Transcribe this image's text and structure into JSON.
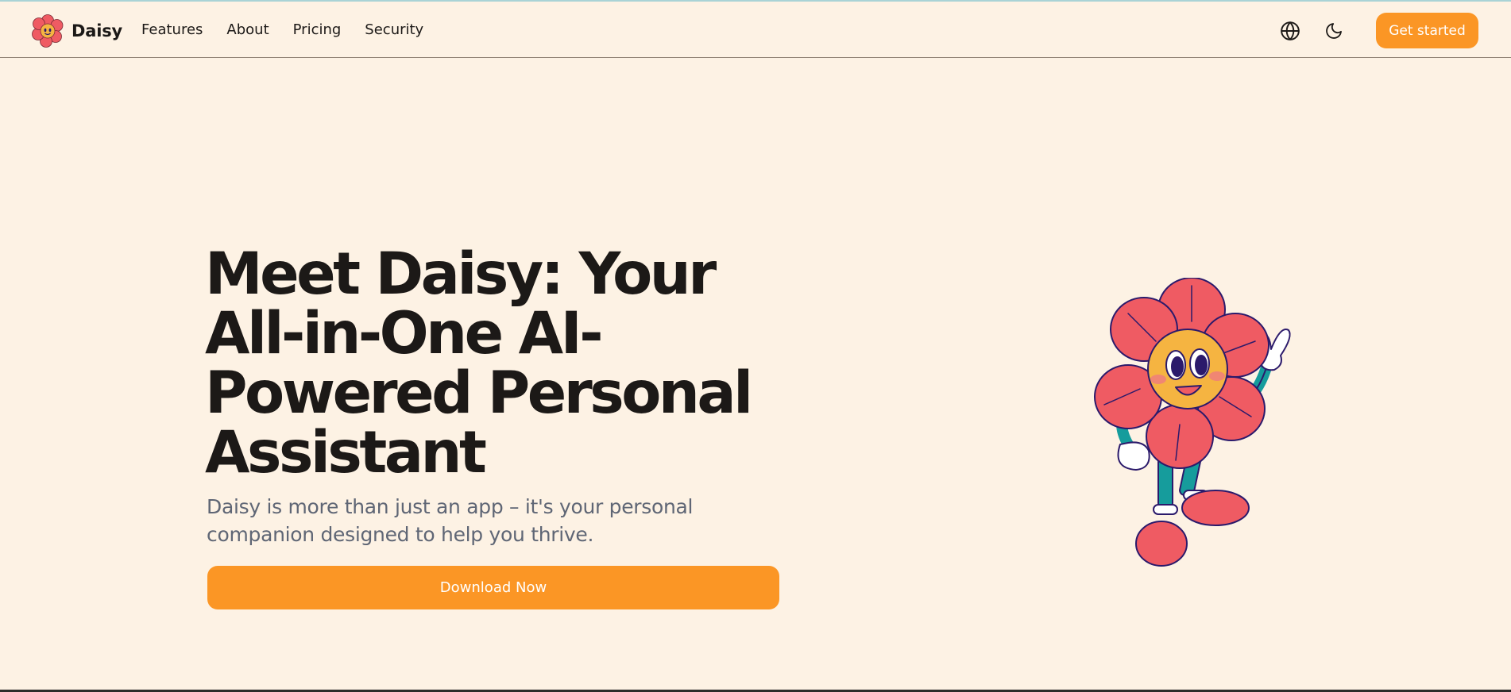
{
  "brand": {
    "name": "Daisy",
    "logo_icon": "daisy-flower-logo"
  },
  "nav": {
    "items": [
      {
        "label": "Features"
      },
      {
        "label": "About"
      },
      {
        "label": "Pricing"
      },
      {
        "label": "Security"
      }
    ],
    "icons": [
      "globe-icon",
      "moon-icon"
    ],
    "cta_label": "Get started"
  },
  "hero": {
    "title": "Meet Daisy: Your All-in-One AI-Powered Personal Assistant",
    "subtitle": "Daisy is more than just an app – it's your personal companion designed to help you thrive.",
    "button_label": "Download Now",
    "illustration": "daisy-flower-mascot"
  },
  "colors": {
    "background": "#fdf2e4",
    "accent": "#fb9625",
    "text": "#1c1917",
    "muted": "#5f6675",
    "petal": "#ef5b63",
    "flower_center": "#f5b441",
    "leg": "#169c9c",
    "outline": "#2b1a6b"
  }
}
